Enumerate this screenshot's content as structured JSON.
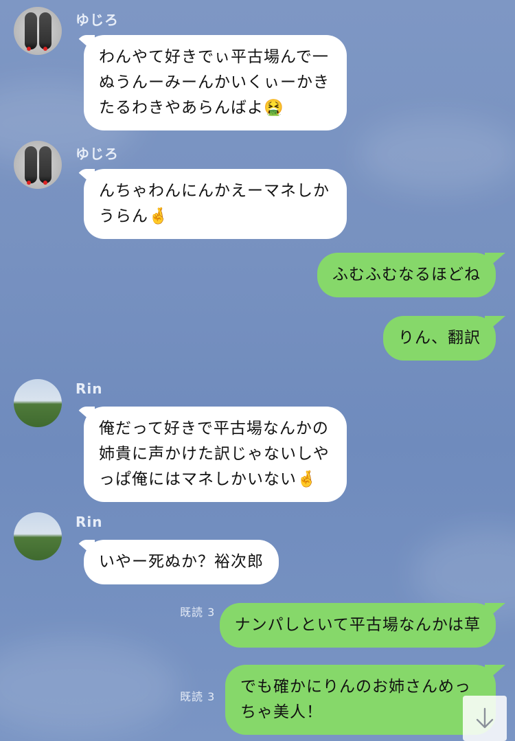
{
  "messages": [
    {
      "sender": "ゆじろ",
      "text": "わんやて好きでぃ平古場んで一ぬうんーみーんかいくぃーかきたるわきやあらんばよ",
      "emoji": "🤮"
    },
    {
      "sender": "ゆじろ",
      "text": "んちゃわんにんかえーマネしかうらん",
      "emoji": "🤞"
    },
    {
      "text": "ふむふむなるほどね"
    },
    {
      "text": "りん、翻訳"
    },
    {
      "sender": "Rin",
      "text": "俺だって好きで平古場なんかの姉貴に声かけた訳じゃないしやっぱ俺にはマネしかいない",
      "emoji": "🤞"
    },
    {
      "sender": "Rin",
      "text": "いやー死ぬか？裕次郎"
    },
    {
      "read": "既読 3",
      "text": "ナンパしといて平古場なんかは草"
    },
    {
      "read": "既読 3",
      "text": "でも確かにりんのお姉さんめっちゃ美人！"
    }
  ],
  "colors": {
    "incoming_bubble": "#ffffff",
    "outgoing_bubble": "#86d86a",
    "background": "#7791c0"
  },
  "icons": {
    "scroll_down": "arrow-down-icon"
  }
}
